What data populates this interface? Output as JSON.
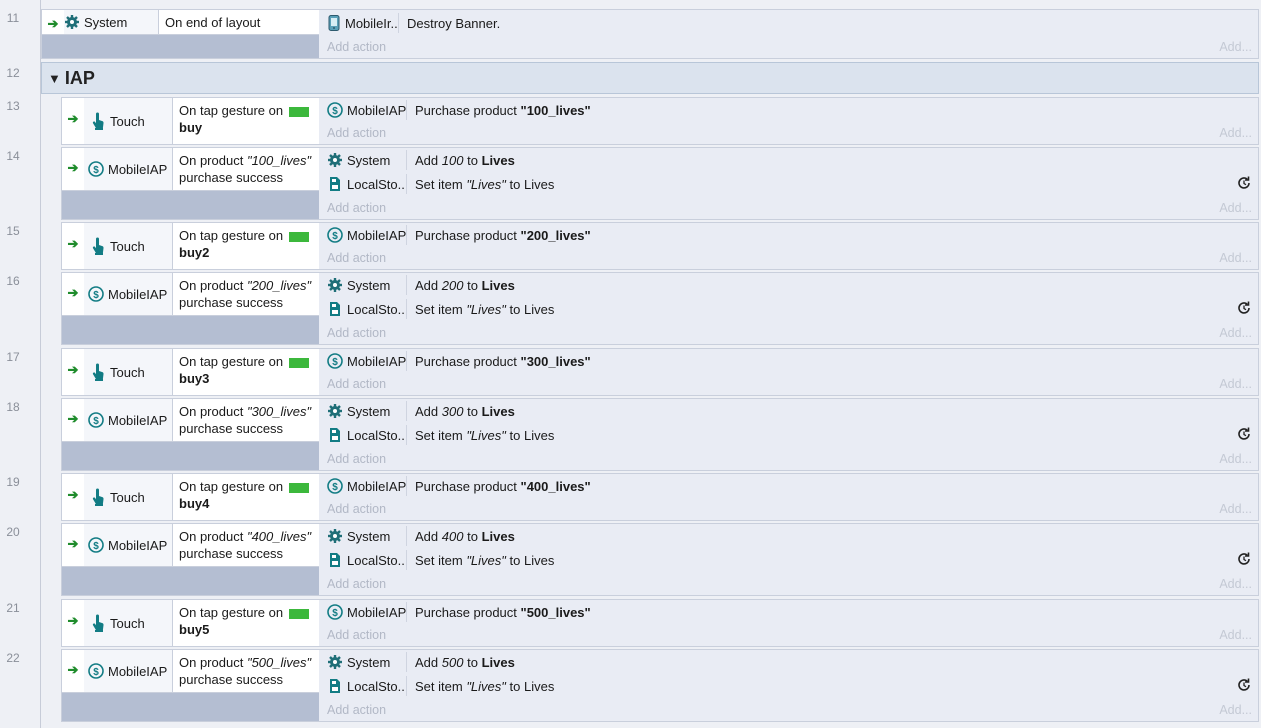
{
  "labels": {
    "add_action": "Add action",
    "add_dots": "Add..."
  },
  "group": {
    "number": "12",
    "name": "IAP"
  },
  "system_event": {
    "number": "11",
    "cond_object": "System",
    "cond_text": "On end of layout",
    "action_object": "MobileIr...",
    "action_text": "Destroy Banner."
  },
  "pairs": [
    {
      "tap": {
        "number": "13",
        "object": "Touch",
        "text": "On tap gesture on",
        "target": "buy",
        "action_object": "MobileIAP",
        "action_prefix": "Purchase product",
        "product": "\"100_lives\""
      },
      "purchase": {
        "number": "14",
        "object": "MobileIAP",
        "text_pre": "On product",
        "product": "\"100_lives\"",
        "text_post": "purchase success",
        "a1_object": "System",
        "a1_pre": "Add",
        "a1_value": "100",
        "a1_mid": "to",
        "a1_var": "Lives",
        "a2_object": "LocalSto...",
        "a2_pre": "Set item",
        "a2_key": "\"Lives\"",
        "a2_post": "to Lives"
      }
    },
    {
      "tap": {
        "number": "15",
        "object": "Touch",
        "text": "On tap gesture on",
        "target": "buy2",
        "action_object": "MobileIAP",
        "action_prefix": "Purchase product",
        "product": "\"200_lives\""
      },
      "purchase": {
        "number": "16",
        "object": "MobileIAP",
        "text_pre": "On product",
        "product": "\"200_lives\"",
        "text_post": "purchase success",
        "a1_object": "System",
        "a1_pre": "Add",
        "a1_value": "200",
        "a1_mid": "to",
        "a1_var": "Lives",
        "a2_object": "LocalSto...",
        "a2_pre": "Set item",
        "a2_key": "\"Lives\"",
        "a2_post": "to Lives"
      }
    },
    {
      "tap": {
        "number": "17",
        "object": "Touch",
        "text": "On tap gesture on",
        "target": "buy3",
        "action_object": "MobileIAP",
        "action_prefix": "Purchase product",
        "product": "\"300_lives\""
      },
      "purchase": {
        "number": "18",
        "object": "MobileIAP",
        "text_pre": "On product",
        "product": "\"300_lives\"",
        "text_post": "purchase success",
        "a1_object": "System",
        "a1_pre": "Add",
        "a1_value": "300",
        "a1_mid": "to",
        "a1_var": "Lives",
        "a2_object": "LocalSto...",
        "a2_pre": "Set item",
        "a2_key": "\"Lives\"",
        "a2_post": "to Lives"
      }
    },
    {
      "tap": {
        "number": "19",
        "object": "Touch",
        "text": "On tap gesture on",
        "target": "buy4",
        "action_object": "MobileIAP",
        "action_prefix": "Purchase product",
        "product": "\"400_lives\""
      },
      "purchase": {
        "number": "20",
        "object": "MobileIAP",
        "text_pre": "On product",
        "product": "\"400_lives\"",
        "text_post": "purchase success",
        "a1_object": "System",
        "a1_pre": "Add",
        "a1_value": "400",
        "a1_mid": "to",
        "a1_var": "Lives",
        "a2_object": "LocalSto...",
        "a2_pre": "Set item",
        "a2_key": "\"Lives\"",
        "a2_post": "to Lives"
      }
    },
    {
      "tap": {
        "number": "21",
        "object": "Touch",
        "text": "On tap gesture on",
        "target": "buy5",
        "action_object": "MobileIAP",
        "action_prefix": "Purchase product",
        "product": "\"500_lives\""
      },
      "purchase": {
        "number": "22",
        "object": "MobileIAP",
        "text_pre": "On product",
        "product": "\"500_lives\"",
        "text_post": "purchase success",
        "a1_object": "System",
        "a1_pre": "Add",
        "a1_value": "500",
        "a1_mid": "to",
        "a1_var": "Lives",
        "a2_object": "LocalSto...",
        "a2_pre": "Set item",
        "a2_key": "\"Lives\"",
        "a2_post": "to Lives"
      }
    }
  ],
  "colors": {
    "accent_green": "#3cb83c",
    "icon_teal": "#127c84"
  }
}
